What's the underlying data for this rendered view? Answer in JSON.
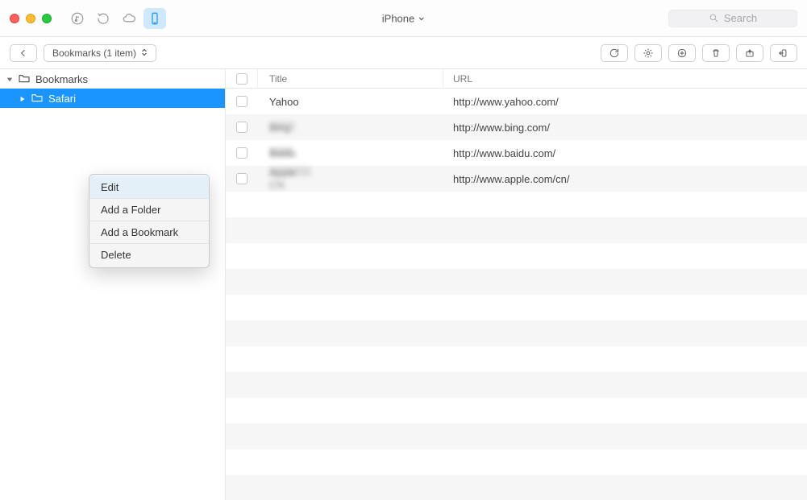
{
  "titlebar": {
    "device_label": "iPhone",
    "search_placeholder": "Search"
  },
  "toolbar": {
    "bookmarks_label": "Bookmarks (1 item)"
  },
  "sidebar": {
    "root_label": "Bookmarks",
    "items": [
      {
        "label": "Safari",
        "selected": true
      }
    ]
  },
  "context_menu": {
    "items": [
      {
        "label": "Edit",
        "hover": true
      },
      {
        "label": "Add a Folder"
      },
      {
        "label": "Add a Bookmark"
      },
      {
        "label": "Delete"
      }
    ]
  },
  "table": {
    "columns": {
      "title": "Title",
      "url": "URL"
    },
    "rows": [
      {
        "title": "Yahoo",
        "url": "http://www.yahoo.com/",
        "blurred_title": false,
        "title_blur_width": 0
      },
      {
        "title": "Bing",
        "url": "http://www.bing.com/",
        "blurred_title": true,
        "title_blur_width": 32
      },
      {
        "title": "Baidu",
        "url": "http://www.baidu.com/",
        "blurred_title": true,
        "title_blur_width": 30
      },
      {
        "title": "Apple CN",
        "url": "http://www.apple.com/cn/",
        "blurred_title": true,
        "title_blur_width": 52
      }
    ]
  }
}
